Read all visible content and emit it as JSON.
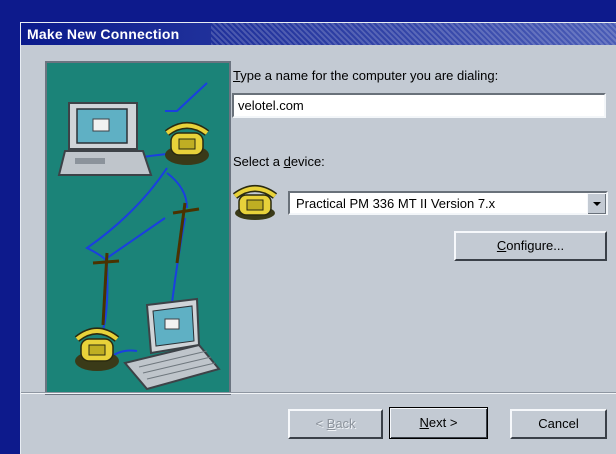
{
  "window": {
    "title": "Make New Connection"
  },
  "form": {
    "name_prompt_pre": "",
    "name_prompt_key": "T",
    "name_prompt_post": "ype a name for the computer you are dialing:",
    "name_value": "velotel.com",
    "device_prompt_pre": "Select a ",
    "device_prompt_key": "d",
    "device_prompt_post": "evice:",
    "device_value": "Practical PM 336 MT II Version 7.x",
    "configure_key": "C",
    "configure_rest": "onfigure..."
  },
  "buttons": {
    "back_arrow": "< ",
    "back_key": "B",
    "back_rest": "ack",
    "next_key": "N",
    "next_rest": "ext >",
    "cancel": "Cancel"
  },
  "colors": {
    "titlebar": "#0a1a8c",
    "dialog_bg": "#c3cad3",
    "illustration_bg": "#1b8378",
    "phone_yellow": "#e8d23a",
    "cable_blue": "#1a3fe0"
  },
  "icons": {
    "illustration": "computer-phone-network-illustration",
    "device": "telephone-icon",
    "dropdown": "chevron-down-icon"
  }
}
